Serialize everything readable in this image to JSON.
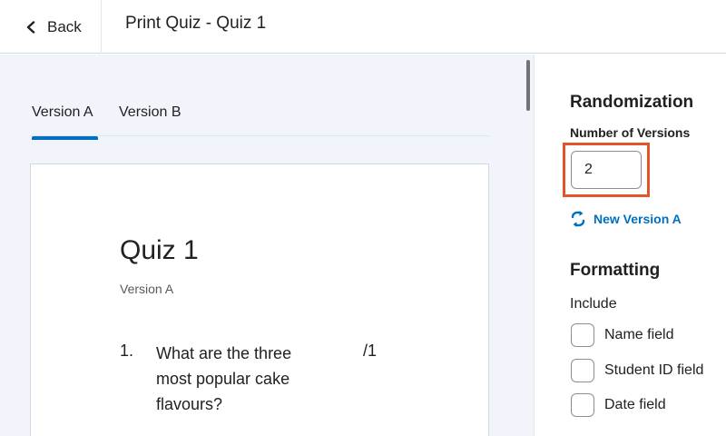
{
  "header": {
    "back_label": "Back",
    "title": "Print Quiz - Quiz 1"
  },
  "tabs": [
    {
      "label": "Version A",
      "selected": true
    },
    {
      "label": "Version B",
      "selected": false
    }
  ],
  "preview": {
    "quiz_title": "Quiz 1",
    "version_label": "Version A",
    "question": {
      "number": "1.",
      "text": "What are the three most popular cake flavours?",
      "points": "/1"
    }
  },
  "sidebar": {
    "randomization_heading": "Randomization",
    "versions_label": "Number of Versions",
    "versions_value": "2",
    "new_version_label": "New Version A",
    "formatting_heading": "Formatting",
    "include_label": "Include",
    "checkboxes": [
      {
        "label": "Name field",
        "checked": false
      },
      {
        "label": "Student ID field",
        "checked": false
      },
      {
        "label": "Date field",
        "checked": false
      }
    ]
  },
  "colors": {
    "accent": "#006fbf",
    "highlight": "#e2552a",
    "preview_bg": "#f1f5fb"
  },
  "icons": {
    "back": "chevron-left-icon",
    "new_version": "refresh-icon"
  }
}
